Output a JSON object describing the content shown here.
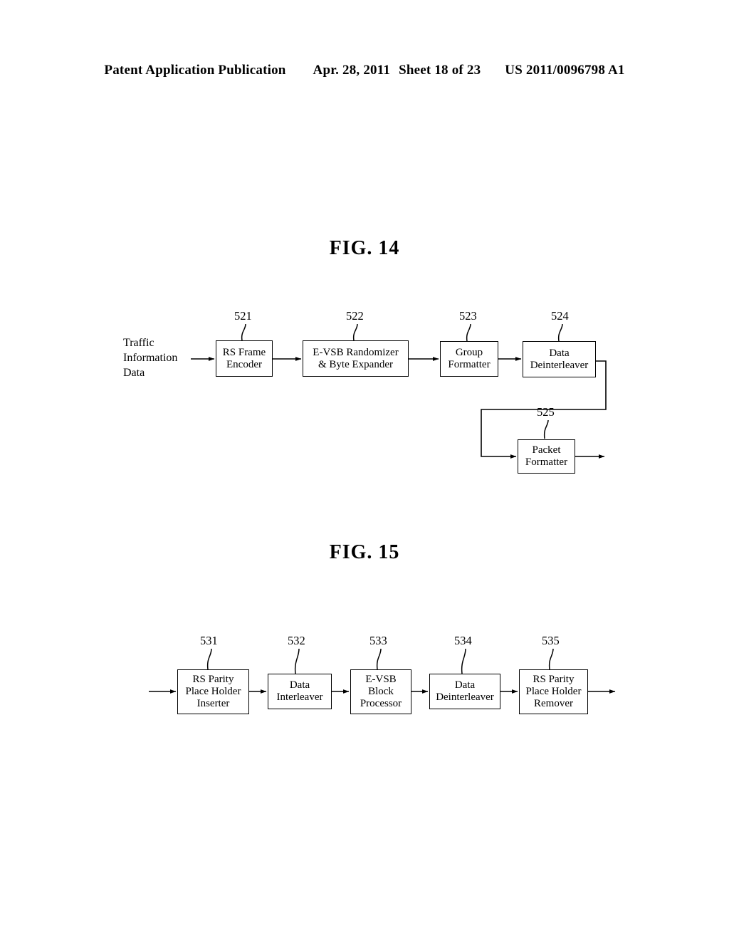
{
  "header": {
    "publication": "Patent Application Publication",
    "date": "Apr. 28, 2011",
    "sheet": "Sheet 18 of 23",
    "patent_number": "US 2011/0096798 A1"
  },
  "figures": [
    {
      "title": "FIG. 14",
      "input_label": {
        "lines": [
          "Traffic",
          "Information",
          "Data"
        ]
      },
      "blocks": [
        {
          "ref": "521",
          "lines": [
            "RS Frame",
            "Encoder"
          ]
        },
        {
          "ref": "522",
          "lines": [
            "E-VSB Randomizer",
            "& Byte Expander"
          ]
        },
        {
          "ref": "523",
          "lines": [
            "Group",
            "Formatter"
          ]
        },
        {
          "ref": "524",
          "lines": [
            "Data",
            "Deinterleaver"
          ]
        },
        {
          "ref": "525",
          "lines": [
            "Packet",
            "Formatter"
          ]
        }
      ]
    },
    {
      "title": "FIG. 15",
      "blocks": [
        {
          "ref": "531",
          "lines": [
            "RS Parity",
            "Place Holder",
            "Inserter"
          ]
        },
        {
          "ref": "532",
          "lines": [
            "Data",
            "Interleaver"
          ]
        },
        {
          "ref": "533",
          "lines": [
            "E-VSB",
            "Block",
            "Processor"
          ]
        },
        {
          "ref": "534",
          "lines": [
            "Data",
            "Deinterleaver"
          ]
        },
        {
          "ref": "535",
          "lines": [
            "RS Parity",
            "Place Holder",
            "Remover"
          ]
        }
      ]
    }
  ],
  "colors": {
    "ink": "#000000",
    "paper": "#ffffff"
  }
}
